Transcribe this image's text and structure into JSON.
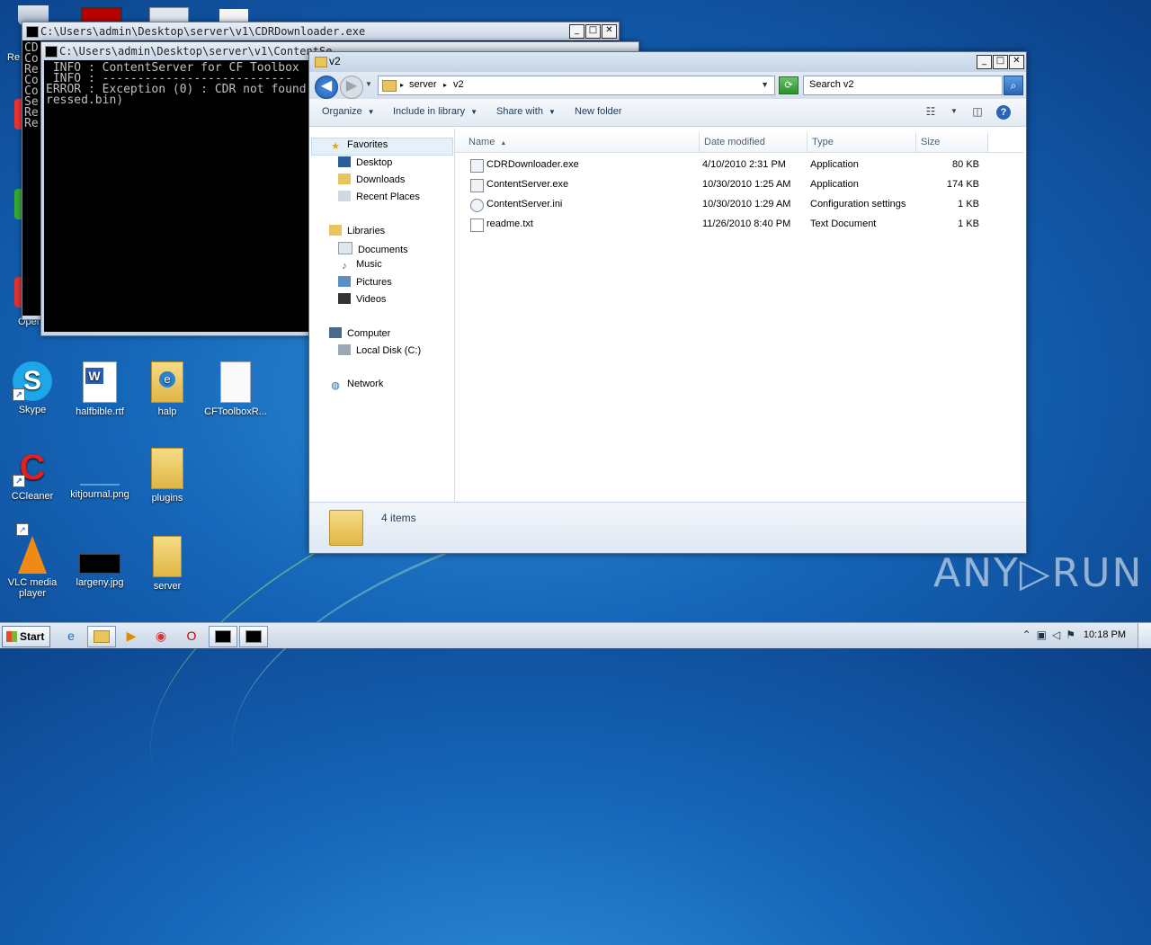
{
  "desktop": {
    "icons": [
      {
        "label": "Skype"
      },
      {
        "label": "halfbible.rtf"
      },
      {
        "label": "halp"
      },
      {
        "label": "CFToolboxR..."
      },
      {
        "label": "CCleaner"
      },
      {
        "label": "kitjournal.png"
      },
      {
        "label": "plugins"
      },
      {
        "label": "VLC media player"
      },
      {
        "label": "largeny.jpg"
      },
      {
        "label": "server"
      }
    ],
    "edge_labels": [
      "Re",
      "Oper"
    ]
  },
  "console_back": {
    "title": "C:\\Users\\admin\\Desktop\\server\\v1\\CDRDownloader.exe",
    "lines": "CD\nCo\nRe\nCo\nCo\nSe\nRe\nRe"
  },
  "console_front": {
    "title": "C:\\Users\\admin\\Desktop\\server\\v1\\ContentSe",
    "lines": " INFO : ContentServer for CF Toolbox\n INFO : ---------------------------\nERROR : Exception (0) : CDR not found\nressed.bin)"
  },
  "explorer": {
    "title": "v2",
    "address": {
      "crumbs": [
        "server",
        "v2"
      ]
    },
    "search_placeholder": "Search v2",
    "toolbar": {
      "organize": "Organize",
      "include_in_library": "Include in library",
      "share_with": "Share with",
      "new_folder": "New folder"
    },
    "nav": {
      "favorites": "Favorites",
      "desktop": "Desktop",
      "downloads": "Downloads",
      "recent_places": "Recent Places",
      "libraries": "Libraries",
      "documents": "Documents",
      "music": "Music",
      "pictures": "Pictures",
      "videos": "Videos",
      "computer": "Computer",
      "local_disk": "Local Disk (C:)",
      "network": "Network"
    },
    "columns": {
      "name": "Name",
      "date": "Date modified",
      "type": "Type",
      "size": "Size"
    },
    "files": [
      {
        "name": "CDRDownloader.exe",
        "date": "4/10/2010 2:31 PM",
        "type": "Application",
        "size": "80 KB"
      },
      {
        "name": "ContentServer.exe",
        "date": "10/30/2010 1:25 AM",
        "type": "Application",
        "size": "174 KB"
      },
      {
        "name": "ContentServer.ini",
        "date": "10/30/2010 1:29 AM",
        "type": "Configuration settings",
        "size": "1 KB"
      },
      {
        "name": "readme.txt",
        "date": "11/26/2010 8:40 PM",
        "type": "Text Document",
        "size": "1 KB"
      }
    ],
    "status": "4 items"
  },
  "taskbar": {
    "start": "Start",
    "clock": "10:18 PM"
  },
  "watermark": "ANY▷RUN"
}
